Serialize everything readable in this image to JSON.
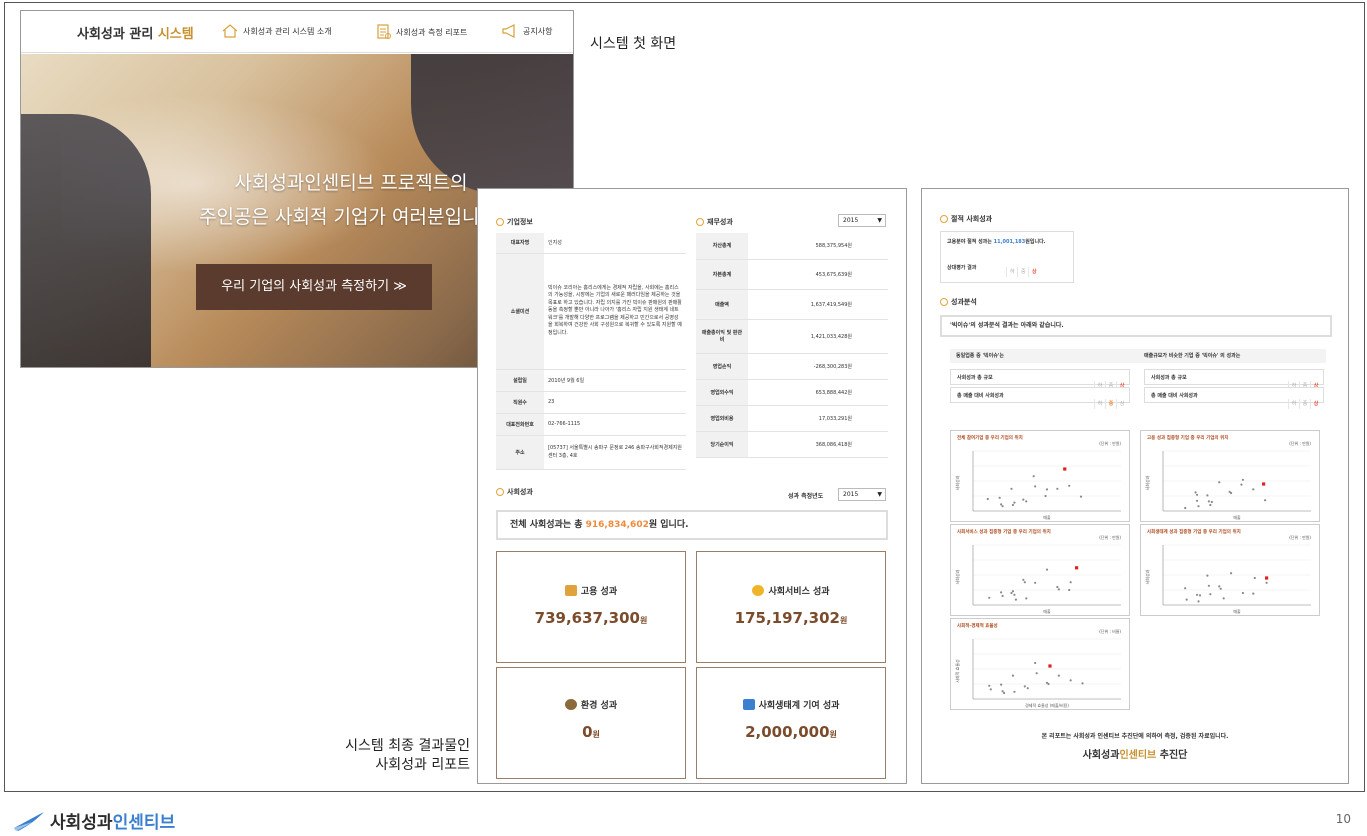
{
  "first_screen": {
    "brand_prefix": "사회성과 관리 ",
    "brand_accent": "시스템",
    "nav": [
      {
        "label": "사회성과 관리 시스템 소개",
        "icon": "house-icon"
      },
      {
        "label": "사회성과 측정 리포트",
        "icon": "report-icon"
      },
      {
        "label": "공지사항",
        "icon": "megaphone-icon"
      }
    ],
    "headline_1": "사회성과인센티브 프로젝트의",
    "headline_2": "주인공은 사회적 기업가 여러분입니다.",
    "cta": "우리 기업의 사회성과 측정하기 ≫"
  },
  "labels": {
    "first_screen": "시스템 첫 화면",
    "final_line1": "시스템 최종 결과물인",
    "final_line2": "사회성과 리포트"
  },
  "report1": {
    "company_title": "기업정보",
    "company_rows": [
      {
        "k": "대표자명",
        "v": "인지성"
      },
      {
        "k": "소셜미션",
        "v": "빅이슈 코리아는 홈리스에게는 경제적 자립을, 사회에는 홈리스의 가능성을, 시장에는 기업의 새로운 패러다임을 제공하는 것을 목표로 하고 있습니다. 자립 의지를 가진 빅이슈 판매원의 판매활동을 측정할 뿐만 아니라 나아가 '홈리스 자립 지원 생태계 네트워크'를 개발해 다양한 프로그램을 제공하고 민간으로서 공영성을 회복하여 건강한 사회 구성원으로 복귀할 수 있도록 지원할 예정입니다."
      },
      {
        "k": "설립일",
        "v": "2010년 9월 6일"
      },
      {
        "k": "직원수",
        "v": "23"
      },
      {
        "k": "대표전화번호",
        "v": "02-766-1115"
      },
      {
        "k": "주소",
        "v": "[05737] 서울특별시 송파구 문정로 246 송파구사회적경제지원센터 3층, 4호"
      }
    ],
    "finance_title": "재무성과",
    "finance_year": "2015",
    "finance_rows": [
      {
        "k": "자산총계",
        "v": "588,375,954원"
      },
      {
        "k": "자본총계",
        "v": "453,675,639원"
      },
      {
        "k": "매출액",
        "v": "1,637,419,549원"
      },
      {
        "k": "매출총이익 및 판관비",
        "v": "1,421,033,428원"
      },
      {
        "k": "영업손익",
        "v": "-268,300,283원"
      },
      {
        "k": "영업외수익",
        "v": "653,888,442원"
      },
      {
        "k": "영업외비용",
        "v": "17,033,291원"
      },
      {
        "k": "당기순이익",
        "v": "368,086,418원"
      }
    ],
    "social_title": "사회성과",
    "measure_label": "성과 측정년도",
    "measure_year": "2015",
    "total_prefix": "전체 사회성과는 총 ",
    "total_amount": "916,834,602",
    "total_suffix": "원 입니다.",
    "perf": [
      {
        "label": "고용 성과",
        "value": "739,637,300",
        "icon": "employment-icon",
        "color": "#e0a23c"
      },
      {
        "label": "사회서비스 성과",
        "value": "175,197,302",
        "icon": "lightbulb-icon",
        "color": "#f0b429"
      },
      {
        "label": "환경 성과",
        "value": "0",
        "icon": "environment-icon",
        "color": "#8a6a3c"
      },
      {
        "label": "사회생태계 기여 성과",
        "value": "2,000,000",
        "icon": "ecosystem-icon",
        "color": "#3b7fd0"
      }
    ],
    "won": "원"
  },
  "report2": {
    "eval_title": "절적 사회성과",
    "eval_line_prefix": "고용분야 절적 성과는 ",
    "eval_line_amount": "11,001,183",
    "eval_line_suffix": "원입니다.",
    "eval_label": "상대평가 결과",
    "ratings": [
      "하",
      "중",
      "상"
    ],
    "analysis_title": "성과분석",
    "analysis_text": "'빅이슈'의 성과분석 결과는 아래와 같습니다.",
    "group_left_title": "동일업종 중 '빅이슈'는",
    "group_right_title": "매출규모가 비슷한 기업 중 '빅이슈' 의 성과는",
    "group_rows": [
      "사회성과 총 규모",
      "총 매출 대비 사회성과"
    ],
    "charts": [
      {
        "title": "전체 참여기업 중 우리 기업의 위치",
        "unit": "(단위 : 만원)",
        "ylabel": "사회성과",
        "xlabel": "매출"
      },
      {
        "title": "고용 성과 집중형 기업 중 우리 기업의 위치",
        "unit": "(단위 : 만원)",
        "ylabel": "사회성과",
        "xlabel": "매출"
      },
      {
        "title": "사회서비스 성과 집중형 기업 중 우리 기업의 위치",
        "unit": "(단위 : 만원)",
        "ylabel": "사회성과",
        "xlabel": "매출"
      },
      {
        "title": "사회생태계 성과 집중형 기업 중 우리 기업의 위치",
        "unit": "(단위 : 만원)",
        "ylabel": "사회성과",
        "xlabel": "매출"
      },
      {
        "title": "사회적-경제적 효율성",
        "unit": "(단위 : 비율)",
        "ylabel": "사회적 효율성",
        "xlabel": "경제적 효율성 (매출/비용)"
      }
    ],
    "footer_note": "본 리포트는 사회성과 인센티브 추진단에 의하여 측정, 검증된 자료입니다.",
    "footer_brand_prefix": "사회성과",
    "footer_brand_accent": "인센티브",
    "footer_brand_suffix": " 추진단"
  },
  "bottom": {
    "logo_prefix": "사회성과",
    "logo_accent": "인센티브",
    "page_number": "10"
  }
}
